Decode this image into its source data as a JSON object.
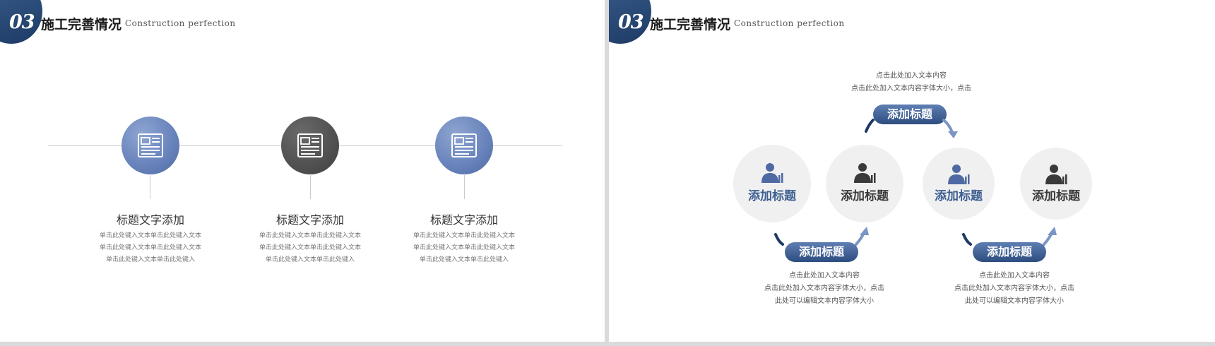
{
  "left_slide": {
    "header": {
      "number": "03",
      "title": "施工完善情况",
      "subtitle": "Construction perfection"
    },
    "items": [
      {
        "title": "标题文字添加",
        "desc": [
          "单击此处键入文本单击此处键入文本",
          "单击此处键入文本单击此处键入文本",
          "单击此处键入文本单击此处键入"
        ],
        "icon": "document-icon",
        "style": "blue"
      },
      {
        "title": "标题文字添加",
        "desc": [
          "单击此处键入文本单击此处键入文本",
          "单击此处键入文本单击此处键入文本",
          "单击此处键入文本单击此处键入"
        ],
        "icon": "document-icon",
        "style": "gray"
      },
      {
        "title": "标题文字添加",
        "desc": [
          "单击此处键入文本单击此处键入文本",
          "单击此处键入文本单击此处键入文本",
          "单击此处键入文本单击此处键入"
        ],
        "icon": "document-icon",
        "style": "blue"
      }
    ]
  },
  "right_slide": {
    "header": {
      "number": "03",
      "title": "施工完善情况",
      "subtitle": "Construction perfection"
    },
    "top_text": [
      "点击此处加入文本内容",
      "点击此处加入文本内容字体大小，点击"
    ],
    "top_pill": "添加标题",
    "circles": [
      {
        "label": "添加标题",
        "icon": "person-chart-icon",
        "style": "blue"
      },
      {
        "label": "添加标题",
        "icon": "person-chart-icon",
        "style": "dark"
      },
      {
        "label": "添加标题",
        "icon": "person-chart-icon",
        "style": "blue"
      },
      {
        "label": "添加标题",
        "icon": "person-chart-icon",
        "style": "dark"
      }
    ],
    "bottom_left": {
      "pill": "添加标题",
      "text": [
        "点击此处加入文本内容",
        "点击此处加入文本内容字体大小，点击",
        "此处可以编辑文本内容字体大小"
      ]
    },
    "bottom_right": {
      "pill": "添加标题",
      "text": [
        "点击此处加入文本内容",
        "点击此处加入文本内容字体大小，点击",
        "此处可以编辑文本内容字体大小"
      ]
    }
  },
  "colors": {
    "accent_blue": "#2d4d80",
    "node_blue": "#6a85bd",
    "node_gray": "#505050",
    "arrow_dark": "#1d3a64",
    "arrow_light": "#7b95c4"
  }
}
